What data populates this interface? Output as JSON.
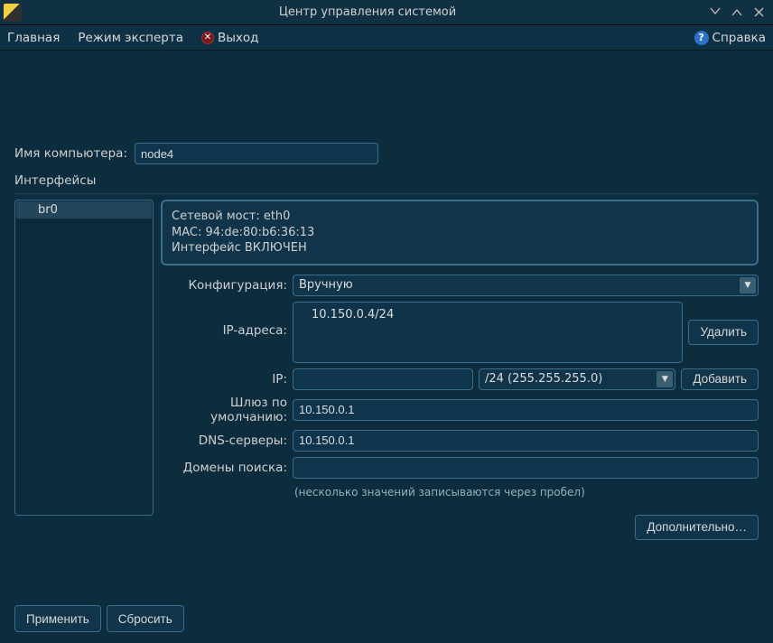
{
  "window": {
    "title": "Центр управления системой"
  },
  "menu": {
    "main": "Главная",
    "expert": "Режим эксперта",
    "exit": "Выход",
    "help": "Справка"
  },
  "hostname_label": "Имя компьютера:",
  "hostname_value": "node4",
  "interfaces_section": "Интерфейсы",
  "interfaces": {
    "item0": "br0"
  },
  "info": {
    "bridge": "Сетевой мост: eth0",
    "mac": "MAC: 94:de:80:b6:36:13",
    "status": "Интерфейс ВКЛЮЧЕН"
  },
  "labels": {
    "config": "Конфигурация:",
    "ips": "IP-адреса:",
    "ip": "IP:",
    "gateway": "Шлюз по умолчанию:",
    "dns": "DNS-серверы:",
    "search": "Домены поиска:",
    "hint": "(несколько значений записываются через пробел)"
  },
  "config_value": "Вручную",
  "ip_list": {
    "item0": "10.150.0.4/24"
  },
  "ip_value": "",
  "mask_value": "/24 (255.255.255.0)",
  "gateway_value": "10.150.0.1",
  "dns_value": "10.150.0.1",
  "search_value": "",
  "buttons": {
    "delete": "Удалить",
    "add": "Добавить",
    "advanced": "Дополнительно…",
    "apply": "Применить",
    "reset": "Сбросить"
  }
}
